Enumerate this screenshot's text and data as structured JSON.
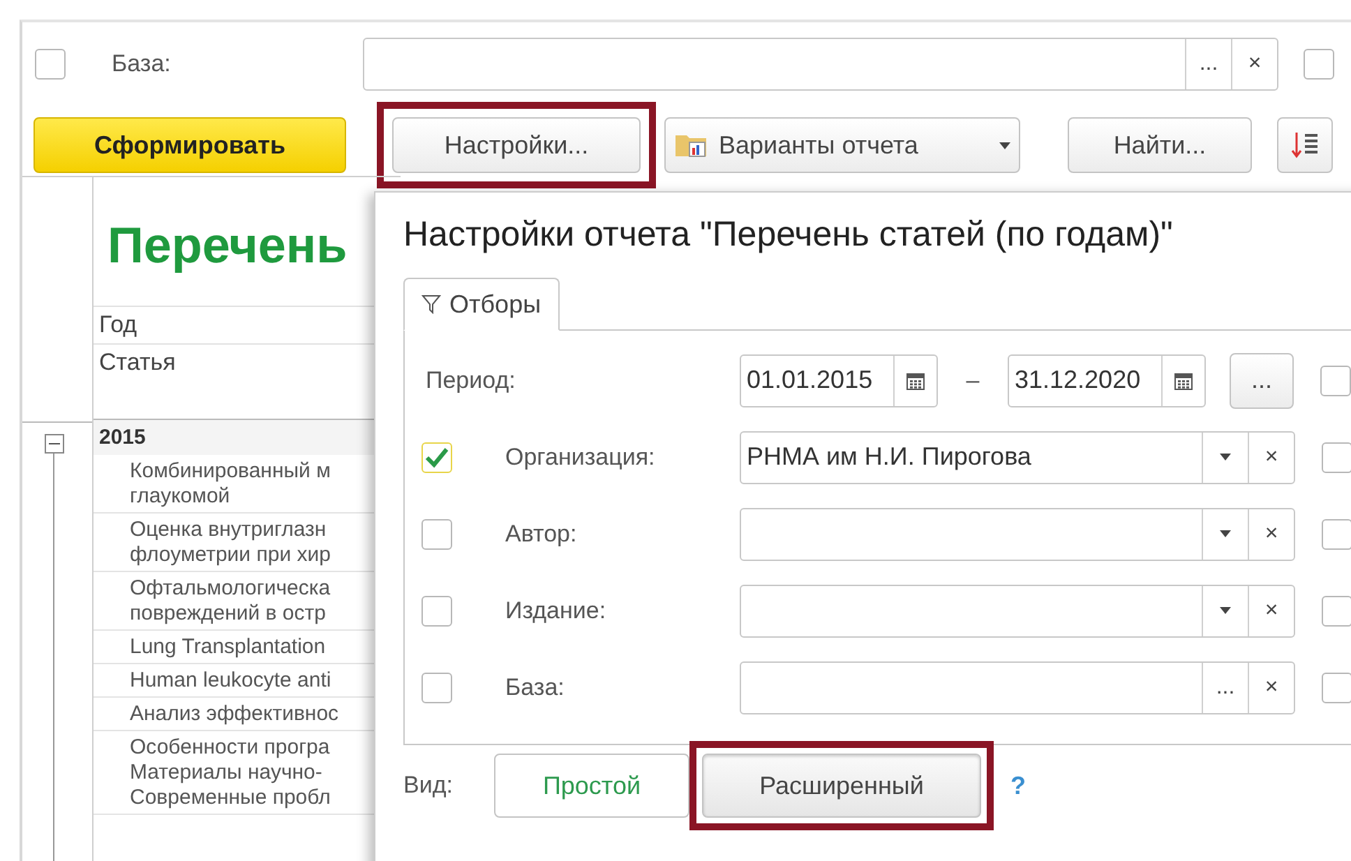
{
  "top_filter": {
    "checked": false,
    "label": "База:",
    "select_button": "...",
    "clear_button": "×",
    "use_checked": false
  },
  "toolbar": {
    "generate": "Сформировать",
    "settings": "Настройки...",
    "variants": "Варианты отчета",
    "find": "Найти..."
  },
  "report": {
    "title": "Перечень",
    "columns": [
      "Год",
      "Статья"
    ],
    "groups": [
      {
        "year": "2015",
        "expanded": true,
        "rows": [
          [
            "Комбинированный м",
            "глаукомой"
          ],
          [
            "Оценка внутриглазн",
            "флоуметрии при хир"
          ],
          [
            "Офтальмологическа",
            "повреждений в остр"
          ],
          [
            "Lung Transplantation"
          ],
          [
            "Human leukocyte anti"
          ],
          [
            "Анализ эффективнос"
          ],
          [
            "Особенности програ",
            "Материалы научно-",
            "Современные пробл"
          ]
        ]
      }
    ]
  },
  "dialog": {
    "title": "Настройки отчета \"Перечень статей (по годам)\"",
    "tabs": [
      {
        "label": "Отборы",
        "selected": true
      }
    ],
    "period": {
      "label": "Период:",
      "from": "01.01.2015",
      "dash": "–",
      "to": "31.12.2020",
      "more_button": "...",
      "use_checked": false
    },
    "filters": [
      {
        "label": "Организация:",
        "checked": true,
        "value": "РНМА им Н.И. Пирогова",
        "kind": "dropdown",
        "clear_button": "×",
        "use_checked": false
      },
      {
        "label": "Автор:",
        "checked": false,
        "kind": "dropdown",
        "clear_button": "×",
        "use_checked": false
      },
      {
        "label": "Издание:",
        "checked": false,
        "kind": "dropdown",
        "clear_button": "×",
        "use_checked": false
      },
      {
        "label": "База:",
        "checked": false,
        "kind": "select",
        "select_button": "...",
        "clear_button": "×",
        "use_checked": false
      }
    ],
    "view": {
      "label": "Вид:",
      "options": [
        {
          "label": "Простой",
          "selected": false
        },
        {
          "label": "Расширенный",
          "selected": true
        }
      ],
      "help": "?"
    }
  }
}
